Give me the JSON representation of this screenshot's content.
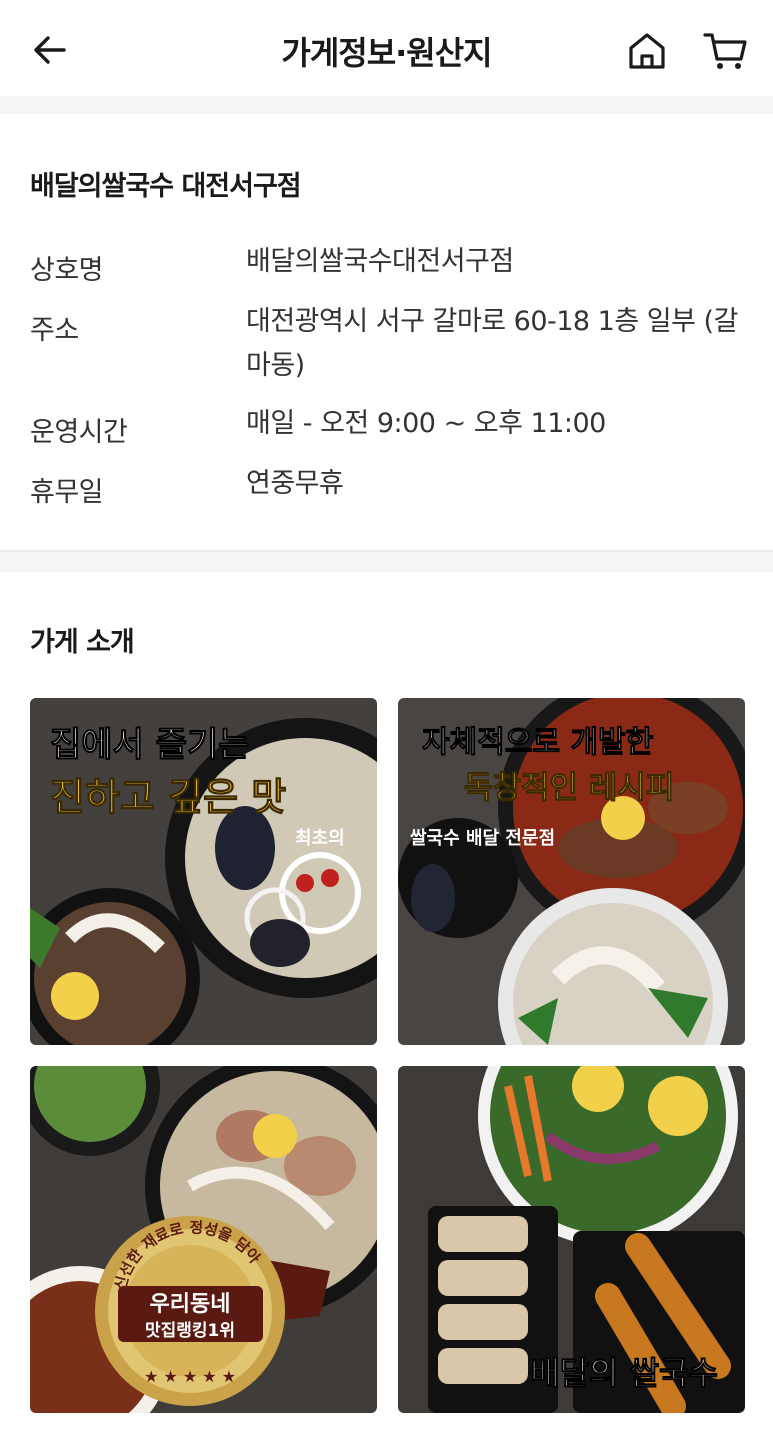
{
  "header": {
    "title": "가게정보·원산지",
    "back_icon": "arrow-left-icon",
    "home_icon": "home-icon",
    "cart_icon": "cart-icon"
  },
  "store": {
    "name": "배달의쌀국수 대전서구점",
    "rows": [
      {
        "key": "상호명",
        "value": "배달의쌀국수대전서구점"
      },
      {
        "key": "주소",
        "value": "대전광역시 서구 갈마로 60-18 1층 일부 (갈마동)"
      },
      {
        "key": "운영시간",
        "value": "매일 - 오전 9:00 ~ 오후 11:00"
      },
      {
        "key": "휴무일",
        "value": "연중무휴"
      }
    ]
  },
  "intro": {
    "title": "가게 소개",
    "images": [
      {
        "line1": "집에서 즐기는",
        "line2": "진하고 깊은 맛",
        "line3": "최초의"
      },
      {
        "line1": "자체적으로 개발한",
        "line2": "독창적인 레시피",
        "line3": "쌀국수 배달 전문점"
      },
      {
        "badge_ring": "신선한 재료로 정성을 담아",
        "badge_main": "우리동네",
        "badge_sub": "맛집랭킹1위"
      },
      {
        "caption": "배달의 쌀국수"
      }
    ]
  },
  "colors": {
    "accent_gold": "#f2c230",
    "text": "#1a1a1a",
    "divider": "#f4f4f4"
  }
}
